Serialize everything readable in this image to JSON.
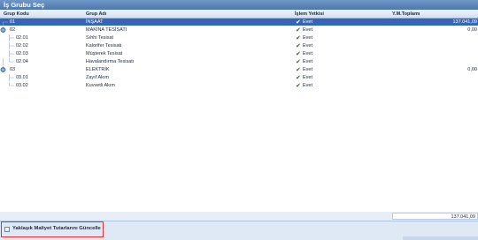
{
  "window": {
    "title": "İş Grubu Seç"
  },
  "grid": {
    "columns": {
      "code": "Grup Kodu",
      "name": "Grup Adı",
      "perm": "İşlem Yetkisi",
      "total": "Y.M.Toplamı"
    },
    "rows": [
      {
        "code": "01",
        "name": "İNŞAAT",
        "perm": "Evet",
        "total": "137.041,09",
        "selected": true
      },
      {
        "code": "02",
        "name": "MAKİNA TESİSATI",
        "perm": "Evet",
        "total": "0,00"
      },
      {
        "code": "02.01",
        "name": "Sıhhi Tesisat",
        "perm": "Evet",
        "total": ""
      },
      {
        "code": "02.02",
        "name": "Kalorifer Tesisatı",
        "perm": "Evet",
        "total": ""
      },
      {
        "code": "02.03",
        "name": "Müşterek Tesisat",
        "perm": "Evet",
        "total": ""
      },
      {
        "code": "02.04",
        "name": "Havalandırma Tesisatı",
        "perm": "Evet",
        "total": ""
      },
      {
        "code": "03",
        "name": "ELEKTRİK",
        "perm": "Evet",
        "total": "0,00"
      },
      {
        "code": "03.01",
        "name": "Zayıf Akım",
        "perm": "Evet",
        "total": ""
      },
      {
        "code": "03.02",
        "name": "Kuvvetli Akım",
        "perm": "Evet",
        "total": ""
      }
    ],
    "sum_total": "137.041,09"
  },
  "actions": {
    "update_label": "Yaklaşık Maliyet Tutarlarını Güncelle"
  },
  "colors": {
    "selected_row": "#3565b8",
    "titlebar": "#5b83b8",
    "highlight_border": "#e0322f"
  }
}
